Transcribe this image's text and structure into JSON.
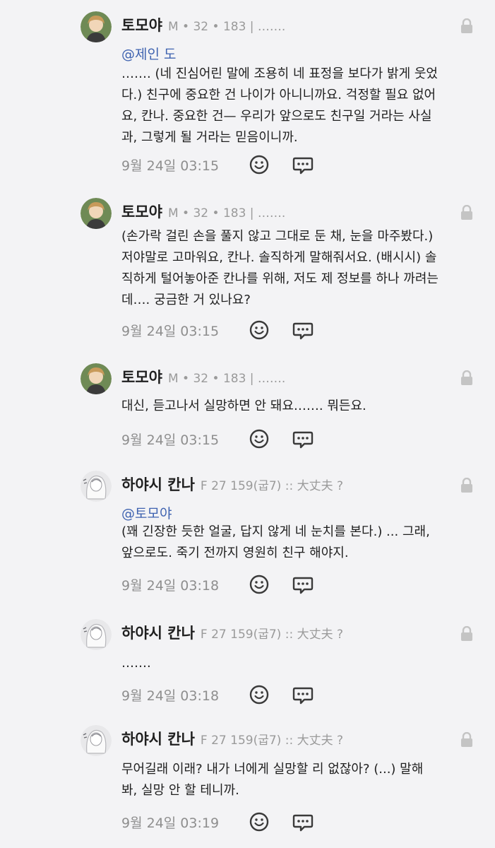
{
  "comments": [
    {
      "author": "토모야",
      "meta": "M • 32 • 183 | …….",
      "avatar": "tomoya-avatar",
      "mention": "@제인 도",
      "lines": [
        "……. (네 진심어린 말에 조용히 네 표정을 보다가 밝게 웃었",
        "다.) 친구에 중요한 건 나이가 아니니까요. 걱정할 필요 없어",
        "요, 칸나. 중요한 건— 우리가 앞으로도 친구일 거라는 사실",
        "과, 그렇게 될 거라는 믿음이니까."
      ],
      "time": "9월 24일 03:15"
    },
    {
      "author": "토모야",
      "meta": "M • 32 • 183 | …….",
      "avatar": "tomoya-avatar",
      "mention": "",
      "lines": [
        "(손가락 걸린 손을 풀지 않고 그대로 둔 채, 눈을 마주봤다.)",
        "저야말로 고마워요, 칸나. 솔직하게 말해줘서요. (배시시) 솔",
        "직하게 털어놓아준 칸나를 위해, 저도 제 정보를 하나 까려는",
        "데…. 궁금한 거 있나요?"
      ],
      "time": "9월 24일 03:15"
    },
    {
      "author": "토모야",
      "meta": "M • 32 • 183 | …….",
      "avatar": "tomoya-avatar",
      "mention": "",
      "lines": [
        "대신, 듣고나서 실망하면 안 돼요……. 뭐든요."
      ],
      "time": "9월 24일 03:15"
    },
    {
      "author": "하야시 칸나",
      "meta": "F 27 159(굽7) :: 大丈夫 ?",
      "avatar": "kanna-avatar",
      "mention": "@토모야",
      "lines": [
        "(꽤 긴장한 듯한 얼굴, 답지 않게 네 눈치를 본다.) ... 그래,",
        "앞으로도. 죽기 전까지 영원히 친구 해야지."
      ],
      "time": "9월 24일 03:18"
    },
    {
      "author": "하야시 칸나",
      "meta": "F 27 159(굽7) :: 大丈夫 ?",
      "avatar": "kanna-avatar",
      "mention": "",
      "lines": [
        "……."
      ],
      "time": "9월 24일 03:18"
    },
    {
      "author": "하야시 칸나",
      "meta": "F 27 159(굽7) :: 大丈夫 ?",
      "avatar": "kanna-avatar",
      "mention": "",
      "lines": [
        "무어길래 이래? 내가 너에게 실망할 리 없잖아? (...) 말해",
        "봐, 실망 안 할 테니까."
      ],
      "time": "9월 24일 03:19"
    }
  ],
  "icons": {
    "lock": "lock-icon",
    "react": "smiley-icon",
    "reply": "speech-bubble-icon"
  },
  "colors": {
    "background": "#f3f3f5",
    "text": "#1f1f1f",
    "meta": "#9a9a9a",
    "mention": "#3f63b0",
    "icon": "#3a3a3a"
  }
}
